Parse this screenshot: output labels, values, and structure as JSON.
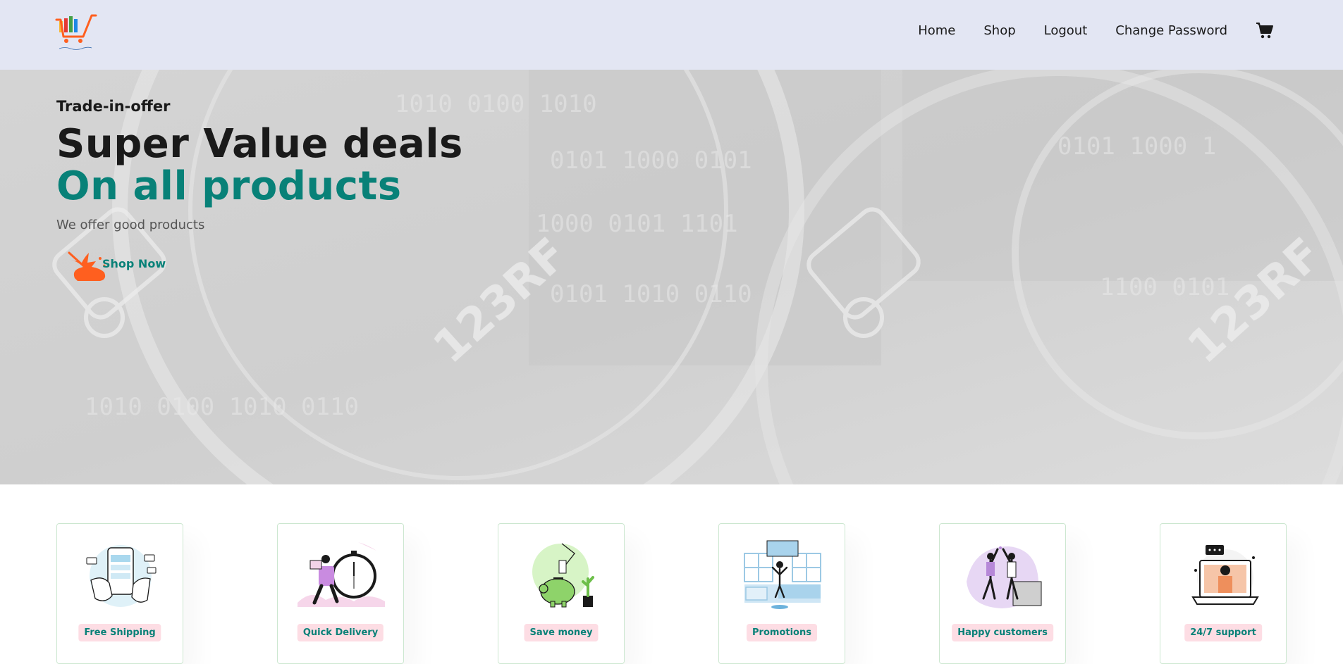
{
  "header": {
    "logo_alt": "E-commerce logo",
    "nav": [
      {
        "label": "Home"
      },
      {
        "label": "Shop"
      },
      {
        "label": "Logout"
      },
      {
        "label": "Change Password"
      }
    ],
    "cart_icon": "shopping-cart-icon"
  },
  "hero": {
    "tagline": "Trade-in-offer",
    "title": "Super Value deals",
    "subtitle": "On all products",
    "description": "We offer good products",
    "button_label": "Shop Now",
    "accent_color": "#088178",
    "button_splash_color": "#ff5f1f"
  },
  "features": [
    {
      "label": "Free Shipping",
      "icon": "phone-payment-illustration",
      "badge_color": "#fddde4"
    },
    {
      "label": "Quick Delivery",
      "icon": "delivery-clock-illustration",
      "badge_color": "#fddde4"
    },
    {
      "label": "Save money",
      "icon": "piggy-bank-illustration",
      "badge_color": "#fddde4"
    },
    {
      "label": "Promotions",
      "icon": "promotions-illustration",
      "badge_color": "#fddde4"
    },
    {
      "label": "Happy customers",
      "icon": "high-five-illustration",
      "badge_color": "#fddde4"
    },
    {
      "label": "24/7 support",
      "icon": "support-laptop-illustration",
      "badge_color": "#fddde4"
    }
  ],
  "colors": {
    "header_bg": "#e3e6f3",
    "primary": "#088178",
    "text_dark": "#1a1a1a"
  }
}
